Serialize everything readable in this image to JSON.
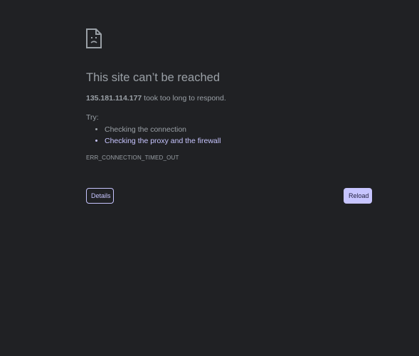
{
  "page": {
    "icon": "sad-document-icon",
    "title": "This site can’t be reached",
    "summary": {
      "host": "135.181.114.177",
      "message": " took too long to respond."
    },
    "try_label": "Try:",
    "suggestions": [
      {
        "label": "Checking the connection",
        "is_link": false
      },
      {
        "label": "Checking the proxy and the firewall",
        "is_link": true
      }
    ],
    "error_code": "ERR_CONNECTION_TIMED_OUT"
  },
  "buttons": {
    "details_label": "Details",
    "reload_label": "Reload"
  },
  "colors": {
    "background": "#202124",
    "text": "#9aa0a6",
    "accent": "#c7c5ff"
  }
}
